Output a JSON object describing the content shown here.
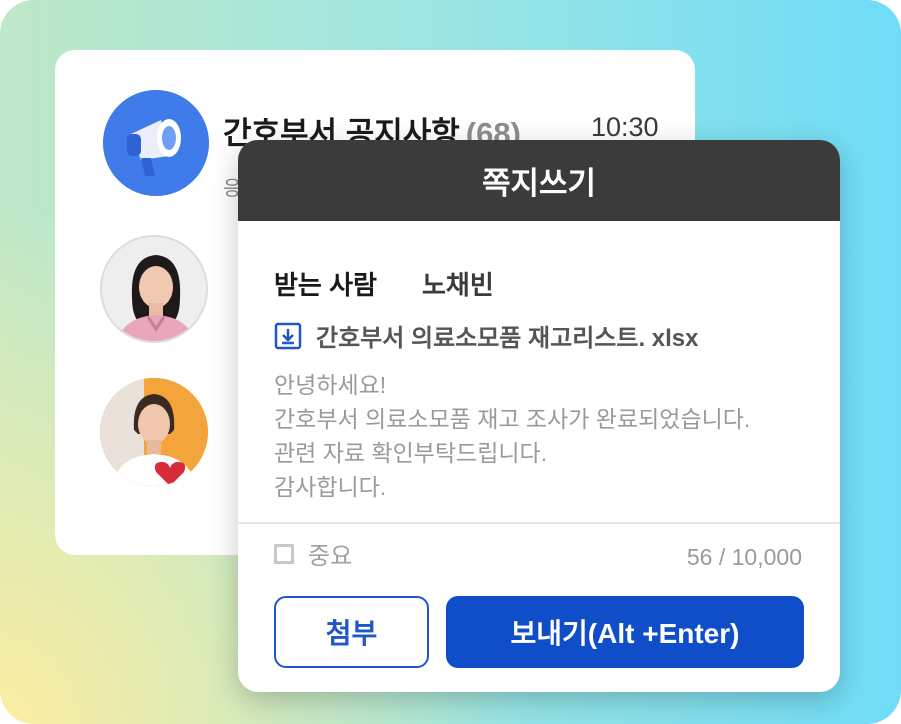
{
  "notice": {
    "title": "간호부서 공지사항",
    "count": "(68)",
    "time": "10:30",
    "preview": "응"
  },
  "modal": {
    "title": "쪽지쓰기",
    "recipient_label": "받는 사람",
    "recipient_name": "노채빈",
    "attachment": "간호부서 의료소모품 재고리스트. xlsx",
    "body_lines": [
      "안녕하세요!",
      "간호부서 의료소모품 재고 조사가 완료되었습니다.",
      "관련 자료 확인부탁드립니다.",
      "감사합니다."
    ],
    "important_label": "중요",
    "counter": "56 / 10,000",
    "attach_button": "첨부",
    "send_button": "보내기(Alt +Enter)"
  },
  "colors": {
    "accent": "#0f4ec8",
    "header": "#3b3b3b",
    "notice_avatar": "#3f7cea"
  },
  "icons": [
    "megaphone-icon",
    "download-file-icon",
    "checkbox-icon"
  ]
}
